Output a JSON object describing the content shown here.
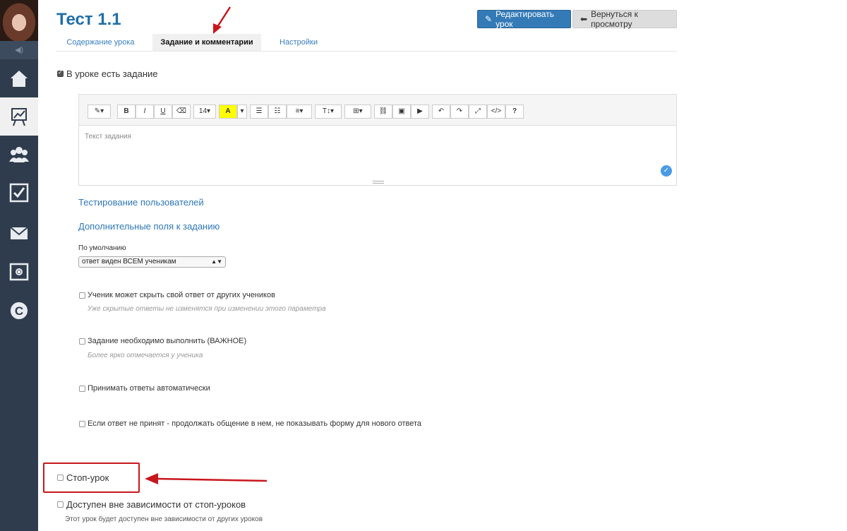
{
  "page": {
    "title": "Тест 1.1",
    "edit_button": "Редактировать урок",
    "back_button": "Вернуться к просмотру"
  },
  "tabs": [
    {
      "label": "Содержание урока",
      "active": false
    },
    {
      "label": "Задание и комментарии",
      "active": true
    },
    {
      "label": "Настройки",
      "active": false
    }
  ],
  "sidebar": {
    "items": [
      "home-icon",
      "chart-board-icon",
      "users-icon",
      "checkbox-icon",
      "mail-icon",
      "safe-icon",
      "c-chat-icon"
    ]
  },
  "task": {
    "has_task_label": "В уроке есть задание",
    "has_task_checked": true,
    "editor_placeholder": "Текст задания",
    "font_size": "14",
    "testing_link": "Тестирование пользователей",
    "extra_fields_link": "Дополнительные поля к заданию"
  },
  "visibility": {
    "label": "По умолчанию",
    "selected": "ответ виден ВСЕМ ученикам"
  },
  "options": [
    {
      "label": "Ученик может скрыть свой ответ от других учеников",
      "hint": "Уже скрытые ответы не изменятся при изменении этого параметра"
    },
    {
      "label": "Задание необходимо выполнить (ВАЖНОЕ)",
      "hint": "Более ярко отмечается у ученика"
    },
    {
      "label": "Принимать ответы автоматически",
      "hint": ""
    },
    {
      "label": "Если ответ не принят - продолжать общение в нем, не показывать форму для нового ответа",
      "hint": ""
    }
  ],
  "stop_lesson": {
    "label": "Стоп-урок",
    "independent_label": "Доступен вне зависимости от стоп-уроков",
    "independent_hint": "Этот урок будет доступен вне зависимости от других уроков"
  },
  "colors": {
    "sidebar": "#2f3c4d",
    "accent": "#337ab7",
    "annotation": "#c8161d"
  }
}
